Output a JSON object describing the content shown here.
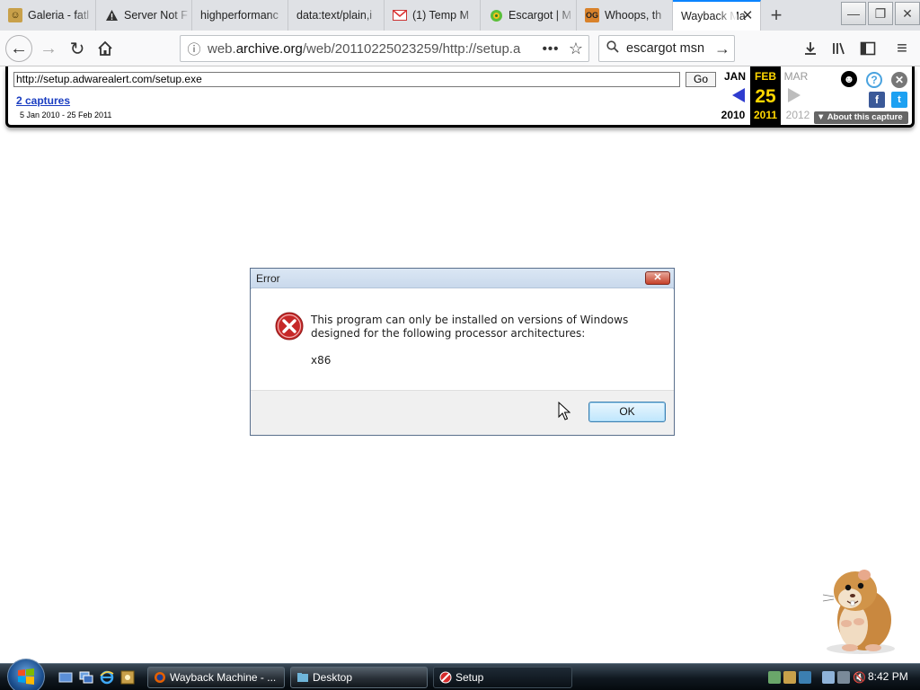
{
  "tabs": [
    {
      "title": "Galeria - fatl",
      "icon": "galeria-favicon"
    },
    {
      "title": "Server Not F",
      "icon": "warning-icon"
    },
    {
      "title": "highperformanc",
      "icon": ""
    },
    {
      "title": "data:text/plain,i",
      "icon": ""
    },
    {
      "title": "(1) Temp M",
      "icon": "gmail-icon"
    },
    {
      "title": "Escargot | M",
      "icon": "escargot-icon"
    },
    {
      "title": "Whoops, th",
      "icon": "og-icon"
    },
    {
      "title": "Wayback Ma",
      "icon": ""
    }
  ],
  "address_bar": {
    "url_prefix": "web.",
    "url_domain": "archive.org",
    "url_rest": "/web/20110225023259/http://setup.a",
    "more_label": "•••"
  },
  "search_bar": {
    "value": "escargot msn"
  },
  "wayback": {
    "url_value": "http://setup.adwarealert.com/setup.exe",
    "go_label": "Go",
    "captures": "2 captures",
    "range": "5 Jan 2010 - 25 Feb 2011",
    "prev_month": "JAN",
    "cur_month": "FEB",
    "next_month": "MAR",
    "cur_day": "25",
    "prev_year": "2010",
    "cur_year": "2011",
    "next_year": "2012",
    "about": "▼ About this capture"
  },
  "dialog": {
    "title": "Error",
    "message": "This program can only be installed on versions of Windows designed for the following processor architectures:",
    "architecture": "x86",
    "ok_label": "OK"
  },
  "taskbar": {
    "tasks": [
      {
        "label": "Wayback Machine - ..."
      },
      {
        "label": "Desktop"
      },
      {
        "label": "Setup"
      }
    ],
    "clock": "8:42 PM"
  },
  "colors": {
    "accent": "#0a84ff",
    "wayback_link": "#1a3dc1",
    "wayback_day": "#ffd700",
    "error_red": "#c62828"
  }
}
